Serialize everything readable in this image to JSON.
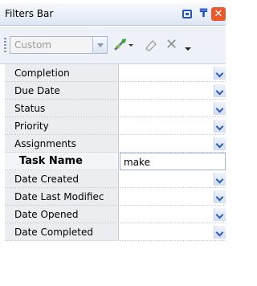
{
  "title_bar": {
    "title": "Filters Bar"
  },
  "toolbar": {
    "combo_value": "Custom"
  },
  "rows": [
    {
      "label": "Completion",
      "value": ""
    },
    {
      "label": "Due Date",
      "value": ""
    },
    {
      "label": "Status",
      "value": ""
    },
    {
      "label": "Priority",
      "value": ""
    },
    {
      "label": "Assignments",
      "value": ""
    },
    {
      "label": "Task Name",
      "value": "make"
    },
    {
      "label": "Date Created",
      "value": ""
    },
    {
      "label": "Date Last Modifiec",
      "value": ""
    },
    {
      "label": "Date Opened",
      "value": ""
    },
    {
      "label": "Date Completed",
      "value": ""
    }
  ],
  "colors": {
    "accent": "#1f55c9",
    "close": "#e85a2c",
    "label_bg": "#ecedf1"
  }
}
